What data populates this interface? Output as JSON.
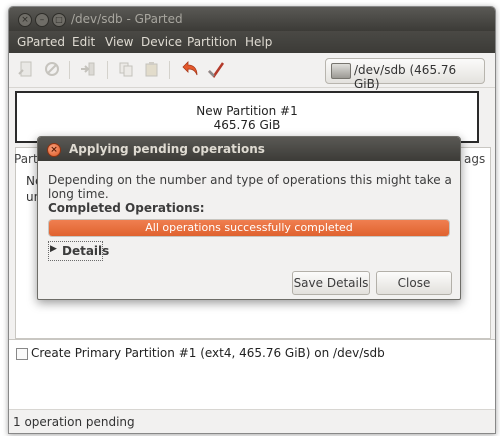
{
  "window": {
    "title": "/dev/sdb - GParted",
    "controls": {
      "close": "×",
      "minimize": "–",
      "maximize": "□"
    }
  },
  "menubar": {
    "items": [
      "GParted",
      "Edit",
      "View",
      "Device",
      "Partition",
      "Help"
    ]
  },
  "toolbar": {
    "device_label": "/dev/sdb   (465.76 GiB)"
  },
  "graph": {
    "partition_name": "New Partition #1",
    "partition_size": "465.76 GiB"
  },
  "table": {
    "col_partition_fragment": "Partit",
    "col_flags_fragment": "ags",
    "row1_fragment": "Ne",
    "row2_fragment": "una"
  },
  "operations": {
    "items": [
      "Create Primary Partition #1 (ext4, 465.76 GiB) on /dev/sdb"
    ]
  },
  "status": {
    "text": "1 operation pending"
  },
  "dialog": {
    "title": "Applying pending operations",
    "message": "Depending on the number and type of operations this might take a long time.",
    "completed_label": "Completed Operations:",
    "progress_text": "All operations successfully completed",
    "progress_fraction": 1.0,
    "details_label": "Details",
    "save_details_label": "Save Details",
    "close_label": "Close"
  },
  "colors": {
    "accent": "#e0622f",
    "titlebar": "#3c3b37",
    "window_bg": "#f2f1f0"
  },
  "icons": [
    "close-icon",
    "minimize-icon",
    "maximize-icon",
    "new-icon",
    "delete-icon",
    "resize-icon",
    "copy-icon",
    "paste-icon",
    "undo-icon",
    "apply-icon",
    "disk-icon",
    "dialog-close-icon",
    "expander-arrow-icon",
    "operation-icon"
  ]
}
